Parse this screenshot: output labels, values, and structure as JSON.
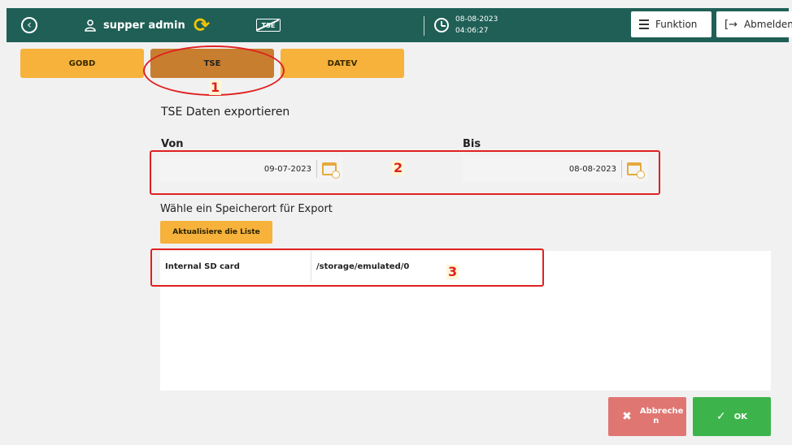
{
  "topbar": {
    "user_name": "supper admin",
    "tse_status_text": "TSE",
    "date": "08-08-2023",
    "time": "04:06:27",
    "funktion_label": "Funktion",
    "abmelden_label": "Abmelden"
  },
  "tabs": [
    {
      "label": "GOBD"
    },
    {
      "label": "TSE"
    },
    {
      "label": "DATEV"
    }
  ],
  "annotations": [
    "1",
    "2",
    "3"
  ],
  "export": {
    "title": "TSE Daten exportieren",
    "von_label": "Von",
    "bis_label": "Bis",
    "von_value": "09-07-2023",
    "bis_value": "08-08-2023"
  },
  "storage": {
    "title": "Wähle ein Speicherort für Export",
    "refresh_label": "Aktualisiere die Liste",
    "rows": [
      {
        "name": "Internal SD card",
        "path": "/storage/emulated/0"
      }
    ]
  },
  "actions": {
    "cancel_label": "Abbreche\nn",
    "ok_label": "OK"
  },
  "colors": {
    "topbar": "#1f5f56",
    "tab": "#f6b23b",
    "tab_active": "#c87e2f",
    "annotation": "#e02020",
    "cancel": "#e07672",
    "ok": "#3db44b"
  }
}
